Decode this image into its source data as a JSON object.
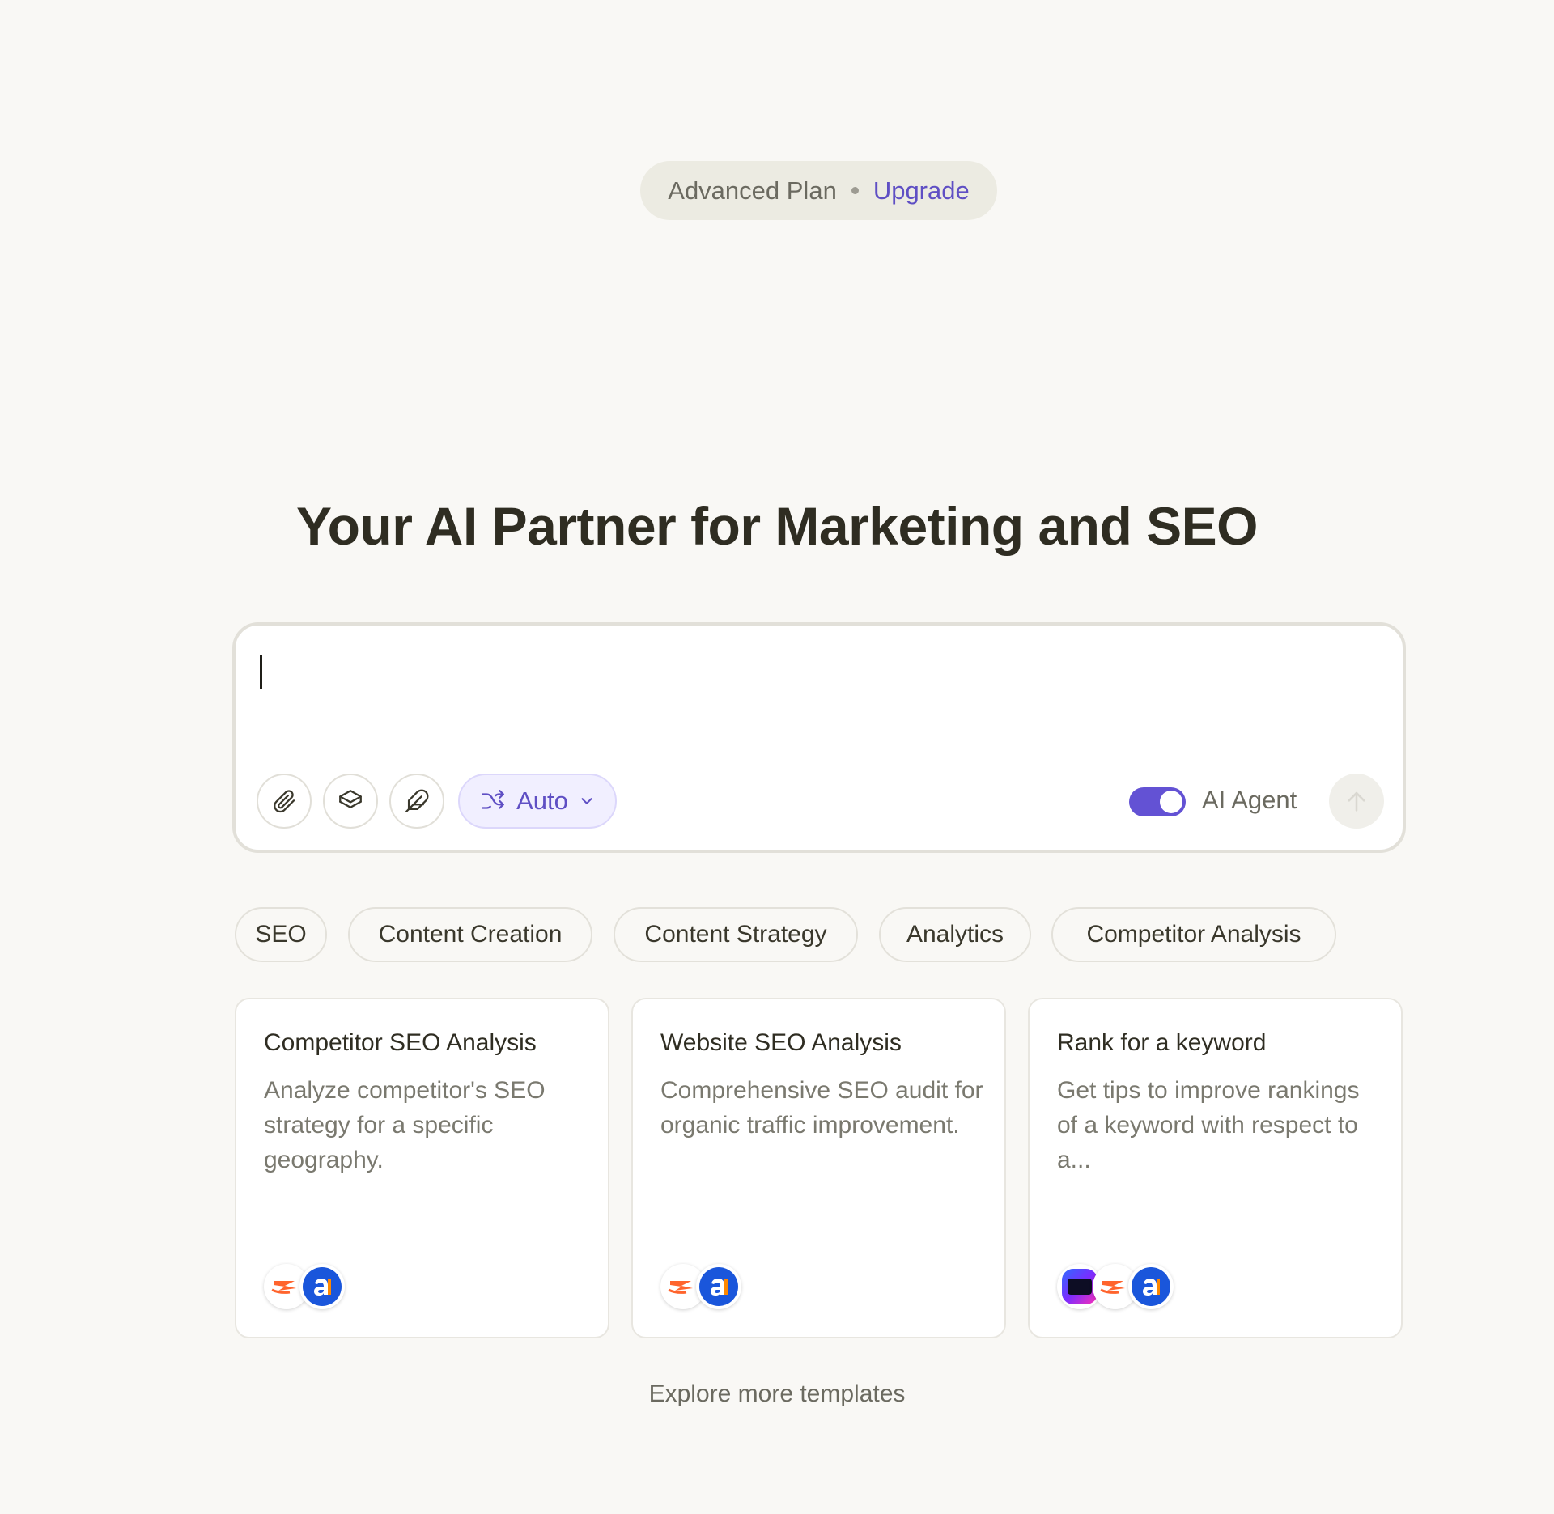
{
  "plan": {
    "name": "Advanced Plan",
    "upgrade_label": "Upgrade"
  },
  "headline": "Your AI Partner for Marketing and SEO",
  "prompt": {
    "value": "",
    "mode_label": "Auto",
    "agent_label": "AI Agent",
    "agent_enabled": true
  },
  "categories": [
    "SEO",
    "Content Creation",
    "Content Strategy",
    "Analytics",
    "Competitor Analysis"
  ],
  "templates": [
    {
      "title": "Competitor SEO Analysis",
      "description": "Analyze competitor's SEO strategy for a specific geography.",
      "logos": [
        "semrush-logo-icon",
        "ahrefs-logo-icon"
      ]
    },
    {
      "title": "Website SEO Analysis",
      "description": "Comprehensive SEO audit for organic traffic improvement.",
      "logos": [
        "semrush-logo-icon",
        "ahrefs-logo-icon"
      ]
    },
    {
      "title": "Rank for a keyword",
      "description": "Get tips to improve rankings of a keyword with respect to a...",
      "logos": [
        "webscraper-logo-icon",
        "semrush-logo-icon",
        "ahrefs-logo-icon"
      ]
    }
  ],
  "explore_label": "Explore more templates",
  "colors": {
    "accent": "#5f4fc4",
    "toggle_on": "#6352d4",
    "background": "#f9f8f5"
  }
}
